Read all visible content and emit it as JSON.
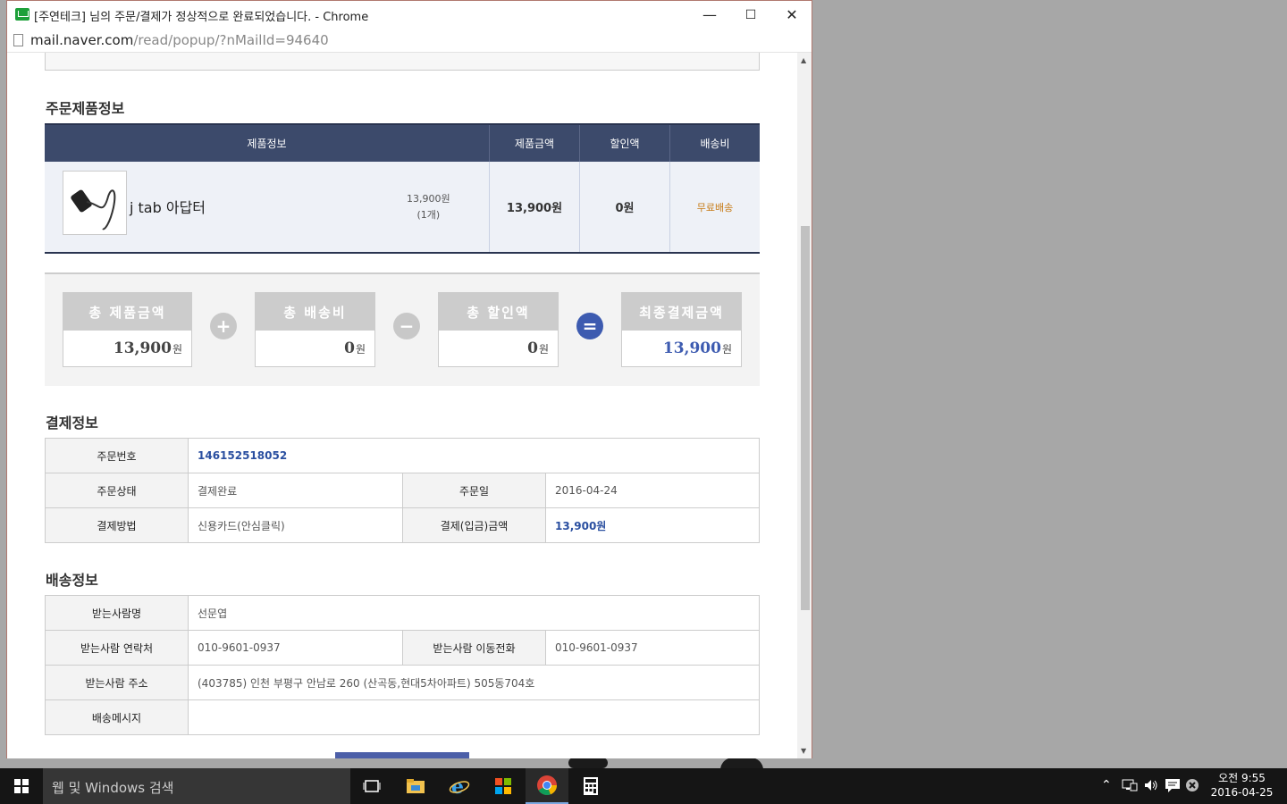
{
  "window": {
    "title": "[주연테크] 님의 주문/결제가 정상적으로 완료되었습니다. - Chrome",
    "url_host": "mail.naver.com",
    "url_path": "/read/popup/?nMailId=94640",
    "minimize": "—",
    "maximize": "☐",
    "close": "✕"
  },
  "order_items": {
    "title": "주문제품정보",
    "columns": [
      "제품정보",
      "제품금액",
      "할인액",
      "배송비"
    ],
    "item": {
      "name": "j tab 아답터",
      "unit_price": "13,900원",
      "quantity": "(1개)",
      "amount": "13,900원",
      "discount": "0원",
      "shipping": "무료배송"
    }
  },
  "summary": {
    "total_products": {
      "label": "총 제품금액",
      "value": "13,900",
      "unit": "원"
    },
    "total_shipping": {
      "label": "총 배송비",
      "value": "0",
      "unit": "원"
    },
    "total_discount": {
      "label": "총 할인액",
      "value": "0",
      "unit": "원"
    },
    "final": {
      "label": "최종결제금액",
      "value": "13,900",
      "unit": "원"
    },
    "plus": "+",
    "minus": "−",
    "equals": "="
  },
  "payment": {
    "title": "결제정보",
    "order_no_label": "주문번호",
    "order_no": "146152518052",
    "status_label": "주문상태",
    "status": "결제완료",
    "date_label": "주문일",
    "date": "2016-04-24",
    "method_label": "결제방법",
    "method": "신용카드(안심클릭)",
    "amount_label": "결제(입금)금액",
    "amount": "13,900원"
  },
  "delivery": {
    "title": "배송정보",
    "name_label": "받는사람명",
    "name": "선문엽",
    "phone_label": "받는사람 연락처",
    "phone": "010-9601-0937",
    "mobile_label": "받는사람 이동전화",
    "mobile": "010-9601-0937",
    "address_label": "받는사람 주소",
    "address": "(403785) 인천 부평구 안남로 260 (산곡동,현대5차아파트) 505동704호",
    "message_label": "배송메시지",
    "message": ""
  },
  "taskbar": {
    "search_placeholder": "웹 및 Windows 검색",
    "time": "오전 9:55",
    "date": "2016-04-25"
  },
  "colors": {
    "header_navy": "#3c4a6b",
    "accent_blue": "#3d5bb0",
    "shipping_orange": "#c77b16"
  }
}
